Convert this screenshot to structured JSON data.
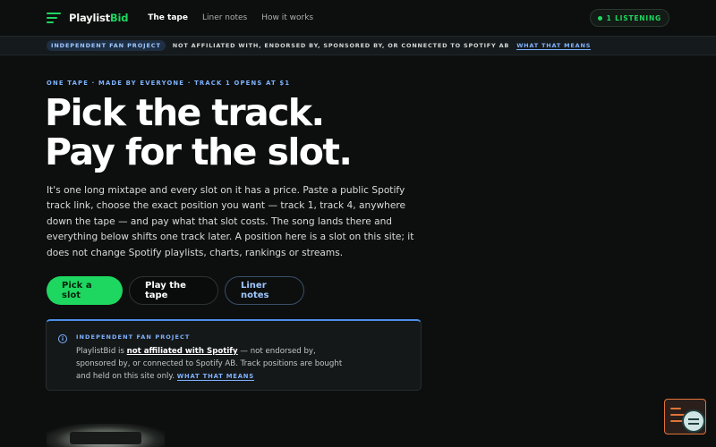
{
  "nav": {
    "logo_main": "Playlist",
    "logo_accent": "Bid",
    "links": [
      "The tape",
      "Liner notes",
      "How it works"
    ],
    "listening": "1 LISTENING"
  },
  "strip": {
    "badge": "INDEPENDENT FAN PROJECT",
    "text": "NOT AFFILIATED WITH, ENDORSED BY, SPONSORED BY, OR CONNECTED TO SPOTIFY AB",
    "link": "WHAT THAT MEANS"
  },
  "hero": {
    "eyebrow": "ONE TAPE · MADE BY EVERYONE · TRACK 1 OPENS AT $1",
    "headline_line1": "Pick the track.",
    "headline_line2": "Pay for the slot.",
    "lede": "It's one long mixtape and every slot on it has a price. Paste a public Spotify track link, choose the exact position you want — track 1, track 4, anywhere down the tape — and pay what that slot costs. The song lands there and everything below shifts one track later. A position here is a slot on this site; it does not change Spotify playlists, charts, rankings or streams."
  },
  "buttons": {
    "primary": "Pick a slot",
    "play": "Play the tape",
    "notes": "Liner notes"
  },
  "notice": {
    "title": "INDEPENDENT FAN PROJECT",
    "body_prefix": "PlaylistBid is ",
    "body_strong": "not affiliated with Spotify",
    "body_rest": " — not endorsed by, sponsored by, or connected to Spotify AB. Track positions are bought and held on this site only.",
    "link": "WHAT THAT MEANS"
  },
  "colors": {
    "accent_green": "#1ed760",
    "accent_blue": "#7fb2ff",
    "background": "#0d0f0e"
  },
  "icons": {
    "logo": "bars-icon",
    "notice": "info-icon",
    "widget": "feedback-chat-icon"
  }
}
